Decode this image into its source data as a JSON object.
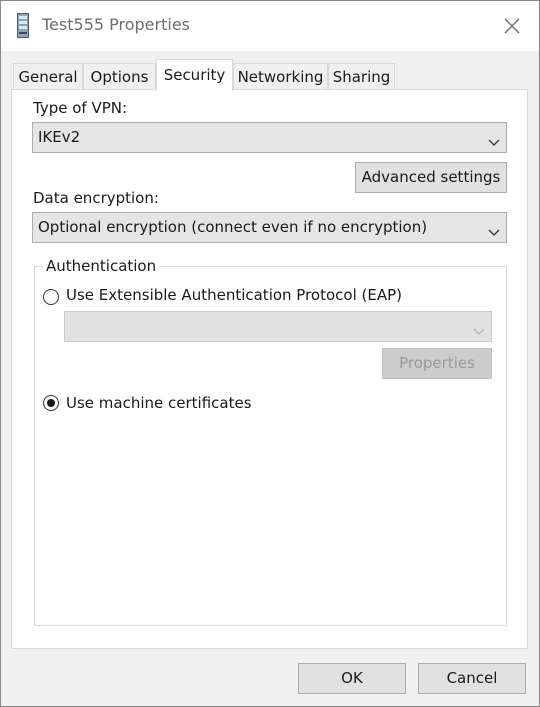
{
  "window": {
    "title": "Test555 Properties",
    "icon": "network-drive-icon",
    "close_icon": "close-icon"
  },
  "tabs": [
    {
      "label": "General",
      "active": false
    },
    {
      "label": "Options",
      "active": false
    },
    {
      "label": "Security",
      "active": true
    },
    {
      "label": "Networking",
      "active": false
    },
    {
      "label": "Sharing",
      "active": false
    }
  ],
  "security": {
    "vpn_type_label": "Type of VPN:",
    "vpn_type_value": "IKEv2",
    "advanced_settings_label": "Advanced settings",
    "data_encryption_label": "Data encryption:",
    "data_encryption_value": "Optional encryption (connect even if no encryption)",
    "authentication": {
      "group_label": "Authentication",
      "eap_option_label": "Use Extensible Authentication Protocol (EAP)",
      "eap_selected": false,
      "eap_method_value": "",
      "properties_label": "Properties",
      "machine_cert_label": "Use machine certificates",
      "machine_cert_selected": true
    }
  },
  "footer": {
    "ok_label": "OK",
    "cancel_label": "Cancel"
  },
  "colors": {
    "panel_bg": "#ffffff",
    "dialog_bg": "#f0f0f0",
    "combo_bg": "#e5e5e5",
    "button_bg": "#e1e1e1",
    "disabled_text": "#9a9a9a"
  }
}
